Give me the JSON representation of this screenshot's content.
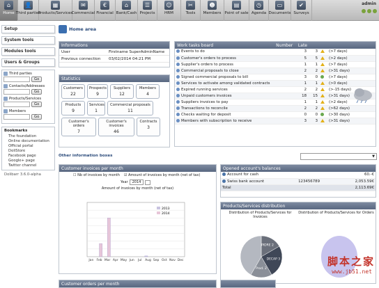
{
  "topbar": {
    "items": [
      {
        "label": "Home",
        "icon": "home-icon",
        "glyph": "⌂"
      },
      {
        "label": "Third parties",
        "icon": "third-parties-icon",
        "glyph": "👤"
      },
      {
        "label": "Products/Services",
        "icon": "products-icon",
        "glyph": "▦"
      },
      {
        "label": "Commercial",
        "icon": "commercial-icon",
        "glyph": "✉"
      },
      {
        "label": "Financial",
        "icon": "financial-icon",
        "glyph": "€"
      },
      {
        "label": "Bank/Cash",
        "icon": "bank-icon",
        "glyph": "⌂"
      },
      {
        "label": "Projects",
        "icon": "projects-icon",
        "glyph": "☰"
      },
      {
        "label": "HRM",
        "icon": "hrm-icon",
        "glyph": "☺"
      },
      {
        "label": "Tools",
        "icon": "tools-icon",
        "glyph": "✂"
      },
      {
        "label": "Members",
        "icon": "members-icon",
        "glyph": "☻"
      },
      {
        "label": "Point of sale",
        "icon": "point-of-sale-icon",
        "glyph": "▤"
      },
      {
        "label": "Agenda",
        "icon": "agenda-icon",
        "glyph": "◷"
      },
      {
        "label": "Documents",
        "icon": "documents-icon",
        "glyph": "▭"
      },
      {
        "label": "Surveys",
        "icon": "surveys-icon",
        "glyph": "✔"
      }
    ],
    "user": "admin"
  },
  "sidebar": {
    "setup": "Setup",
    "system_tools": "System tools",
    "modules_tools": "Modules tools",
    "users_groups": "Users & Groups",
    "quick": [
      {
        "label": "Third parties",
        "btn": "Go"
      },
      {
        "label": "Contacts/Addresses",
        "btn": "Go"
      },
      {
        "label": "Products/Services",
        "btn": "Go"
      },
      {
        "label": "Members",
        "btn": "Go"
      }
    ],
    "bookmarks_title": "Bookmarks",
    "bookmarks": [
      "The foundation",
      "Online documentation",
      "Official portal",
      "DoliStore",
      "Facebook page",
      "Google+ page",
      "Twitter channel"
    ],
    "version": "Dolibarr 3.6.0-alpha"
  },
  "home": {
    "title": "Home area"
  },
  "informations": {
    "title": "Informations",
    "rows": [
      {
        "label": "User",
        "value": "Firstname SuperAdminName"
      },
      {
        "label": "Previous connection",
        "value": "03/02/2014 04:21 PM"
      }
    ]
  },
  "statistics": {
    "title": "Statistics",
    "boxes": [
      {
        "label": "Customers",
        "value": "22"
      },
      {
        "label": "Prospects",
        "value": "9"
      },
      {
        "label": "Suppliers",
        "value": "12"
      },
      {
        "label": "Members",
        "value": "4"
      },
      {
        "label": "Products",
        "value": "9"
      },
      {
        "label": "Services",
        "value": "1"
      },
      {
        "label": "Commercial proposals",
        "value": "11"
      },
      {
        "label": "Customer's orders",
        "value": "7"
      },
      {
        "label": "Customer's invoices",
        "value": "46"
      },
      {
        "label": "Contracts",
        "value": "3"
      }
    ]
  },
  "workboard": {
    "title": "Work tasks board",
    "col_number": "Number",
    "col_late": "Late",
    "rows": [
      {
        "label": "Events to do",
        "number": "3",
        "late": "3",
        "delay": "(>7 days)"
      },
      {
        "label": "Customer's orders to process",
        "number": "5",
        "late": "5",
        "delay": "(>2 days)"
      },
      {
        "label": "Supplier's orders to process",
        "number": "1",
        "late": "1",
        "delay": "(>7 days)"
      },
      {
        "label": "Commercial proposals to close",
        "number": "2",
        "late": "2",
        "delay": "(>31 days)"
      },
      {
        "label": "Signed commercial proposals to bill",
        "number": "3",
        "late": "0",
        "delay": "(>7 days)"
      },
      {
        "label": "Services to activate among validated contracts",
        "number": "1",
        "late": "1",
        "delay": "(>0 days)"
      },
      {
        "label": "Expired running services",
        "number": "2",
        "late": "2",
        "delay": "(>-15 days)"
      },
      {
        "label": "Unpaid customers invoices",
        "number": "18",
        "late": "15",
        "delay": "(>31 days)"
      },
      {
        "label": "Suppliers invoices to pay",
        "number": "1",
        "late": "1",
        "delay": "(>2 days)"
      },
      {
        "label": "Transactions to reconcile",
        "number": "2",
        "late": "2",
        "delay": "(>62 days)"
      },
      {
        "label": "Checks waiting for deposit",
        "number": "0",
        "late": "0",
        "delay": "(>30 days)"
      },
      {
        "label": "Members with subscription to receive",
        "number": "3",
        "late": "3",
        "delay": "(>31 days)"
      }
    ]
  },
  "other_boxes": {
    "label": "Other information boxes"
  },
  "invoices_box": {
    "title": "Customer invoices per month",
    "opt1": "Nb of invoices by month",
    "opt2": "Amount of invoices by month (net of tax)",
    "year_label": "Year",
    "year_value": "2014",
    "chart_title": "Amount of invoices by month (net of tax)"
  },
  "balances": {
    "title": "Opened account's balances",
    "rows": [
      {
        "label": "Account for cash",
        "number": "",
        "amount": "60.-€"
      },
      {
        "label": "Swiss bank account",
        "number": "123456789",
        "amount": "2,053.59€"
      }
    ],
    "total_label": "Total",
    "total_amount": "2,113.69€"
  },
  "products_dist": {
    "title": "Products/Services distribution",
    "t1": "Distribution of Products/Services for Invoices",
    "t2": "Distribution of Products/Services for Orders"
  },
  "orders_box": {
    "title": "Customer orders per month"
  },
  "watermark": {
    "cn": "脚本之家",
    "url": "www.jb51.net"
  },
  "chart_data": [
    {
      "type": "bar",
      "title": "Amount of invoices by month (net of tax)",
      "categories": [
        "Jan",
        "Feb",
        "Mar",
        "Apr",
        "May",
        "Jun",
        "Jul",
        "Aug",
        "Sep",
        "Oct",
        "Nov",
        "Dec"
      ],
      "series": [
        {
          "name": "2013",
          "values": [
            0,
            0,
            0,
            0,
            0,
            0,
            0,
            0,
            0,
            0,
            0,
            0
          ],
          "color": "#c9c3e0"
        },
        {
          "name": "2014",
          "values": [
            0,
            1700,
            5000,
            0,
            0,
            0,
            0,
            0,
            0,
            0,
            0,
            0
          ],
          "color": "#e7c6d9"
        }
      ],
      "series_2013_small_offset": [
        0,
        0,
        0,
        0,
        0,
        0,
        0,
        100,
        0,
        0,
        0,
        0
      ],
      "ylim": [
        0,
        7000
      ],
      "legend": "right"
    },
    {
      "type": "pie",
      "title": "Distribution of Products/Services for Invoices",
      "slices": [
        {
          "label": "PIDRE",
          "value": 2
        },
        {
          "label": "DECAP",
          "value": 3
        },
        {
          "label": "Prod.",
          "value": 2
        },
        {
          "label": "",
          "value": 5
        }
      ]
    }
  ]
}
